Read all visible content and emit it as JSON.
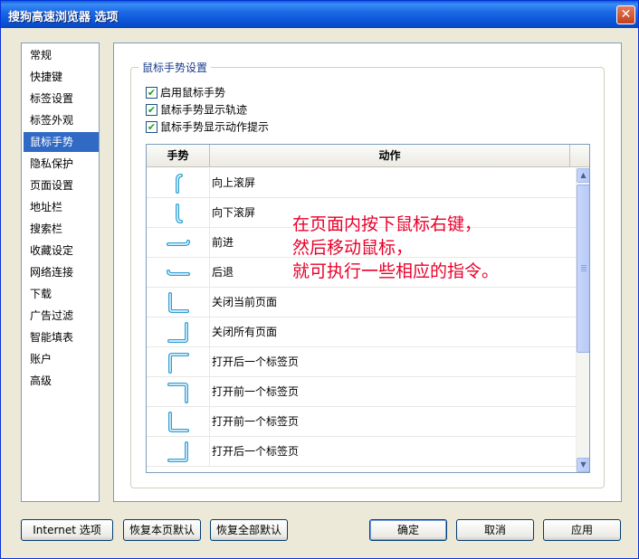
{
  "window": {
    "title": "搜狗高速浏览器 选项",
    "close_glyph": "✕"
  },
  "sidebar": {
    "items": [
      "常规",
      "快捷键",
      "标签设置",
      "标签外观",
      "鼠标手势",
      "隐私保护",
      "页面设置",
      "地址栏",
      "搜索栏",
      "收藏设定",
      "网络连接",
      "下载",
      "广告过滤",
      "智能填表",
      "账户",
      "高级"
    ],
    "active_index": 4
  },
  "group": {
    "title": "鼠标手势设置"
  },
  "options": [
    {
      "label": "启用鼠标手势",
      "checked": true
    },
    {
      "label": "鼠标手势显示轨迹",
      "checked": true
    },
    {
      "label": "鼠标手势显示动作提示",
      "checked": true
    }
  ],
  "table": {
    "headers": {
      "gesture": "手势",
      "action": "动作"
    },
    "rows": [
      {
        "gesture_icon": "gesture-up-icon",
        "action": "向上滚屏"
      },
      {
        "gesture_icon": "gesture-down-icon",
        "action": "向下滚屏"
      },
      {
        "gesture_icon": "gesture-right-icon",
        "action": "前进"
      },
      {
        "gesture_icon": "gesture-left-icon",
        "action": "后退"
      },
      {
        "gesture_icon": "gesture-down-right-icon",
        "action": "关闭当前页面"
      },
      {
        "gesture_icon": "gesture-right-up-icon",
        "action": "关闭所有页面"
      },
      {
        "gesture_icon": "gesture-up-right-icon",
        "action": "打开后一个标签页"
      },
      {
        "gesture_icon": "gesture-right-down-icon",
        "action": "打开前一个标签页"
      },
      {
        "gesture_icon": "gesture-down-right-icon",
        "action": "打开前一个标签页"
      },
      {
        "gesture_icon": "gesture-right-up-icon",
        "action": "打开后一个标签页"
      }
    ]
  },
  "overlay_text": [
    "在页面内按下鼠标右键，",
    "然后移动鼠标，",
    "就可执行一些相应的指令。"
  ],
  "buttons": {
    "internet": "Internet 选项",
    "restore_page": "恢复本页默认",
    "restore_all": "恢复全部默认",
    "ok": "确定",
    "cancel": "取消",
    "apply": "应用"
  },
  "colors": {
    "accent": "#316ac5",
    "gesture_stroke": "#2a9fd6",
    "overlay": "#e8002a",
    "check": "#21a121"
  }
}
